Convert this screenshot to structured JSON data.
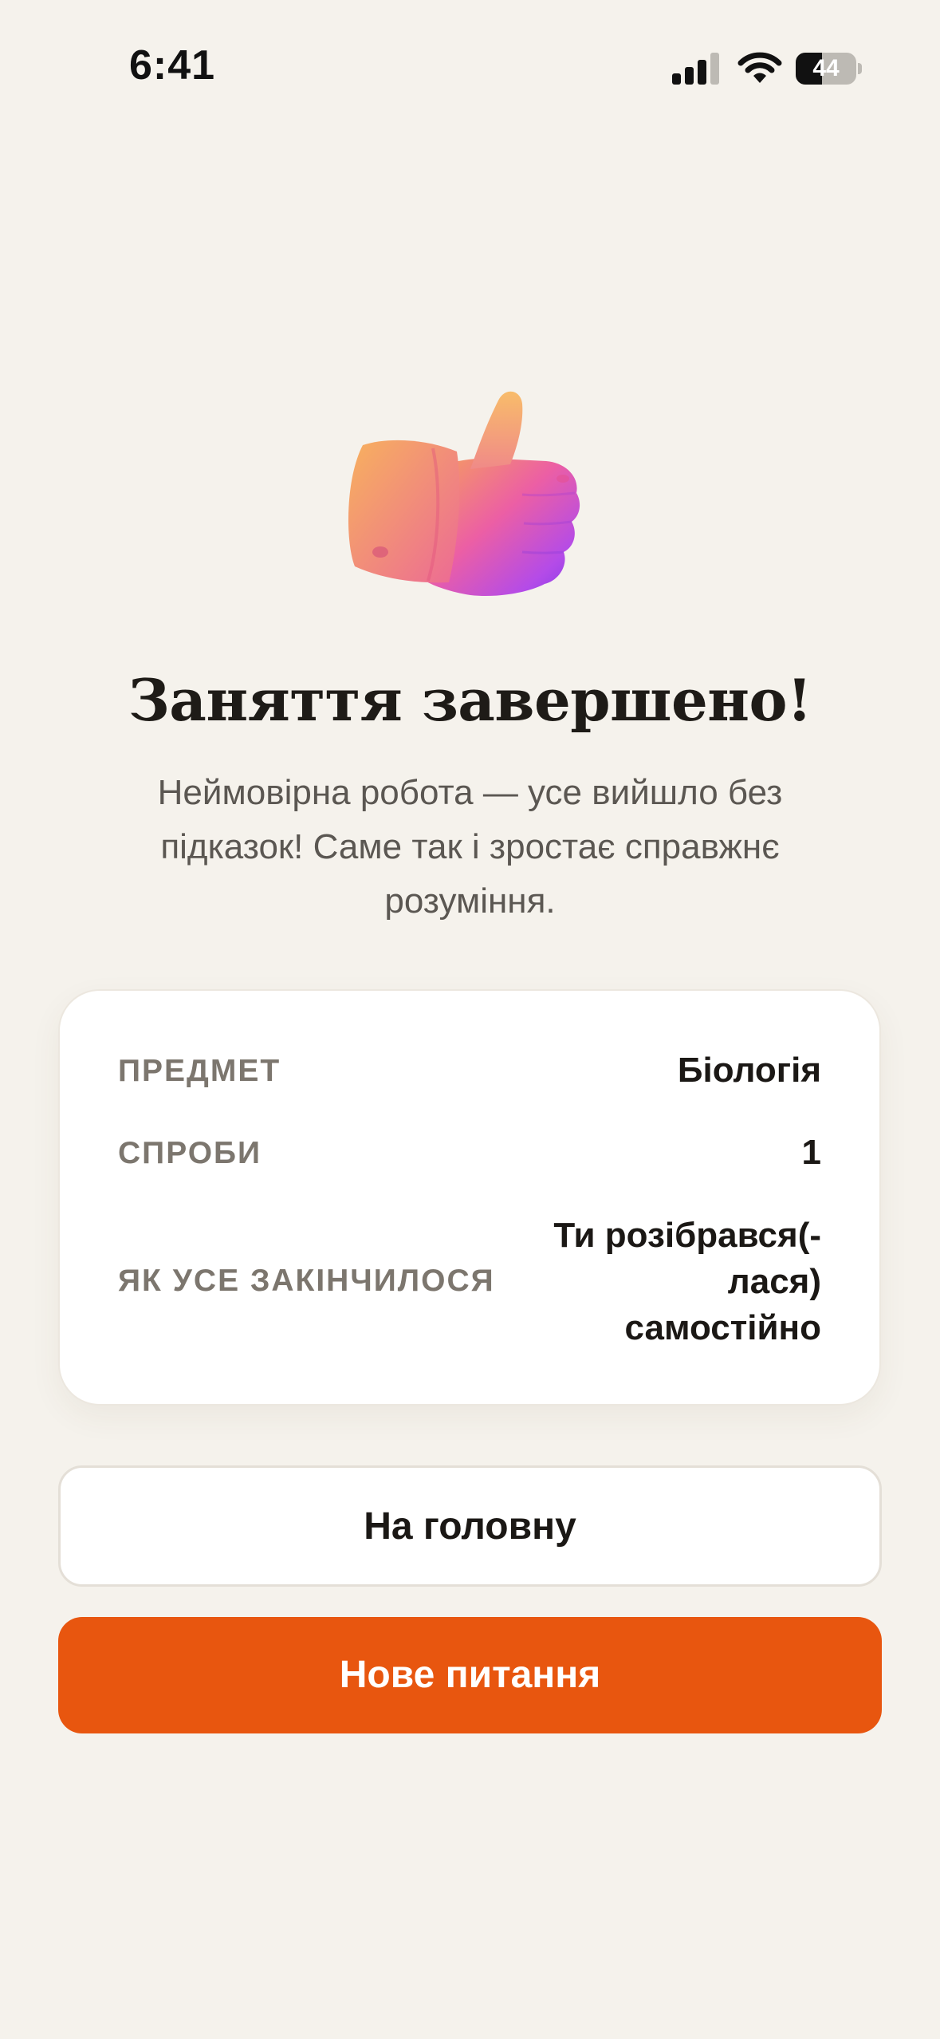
{
  "status_bar": {
    "time": "6:41",
    "battery_level": "44",
    "battery_fraction": 0.44
  },
  "icons": {
    "hero": "thumbs-up-icon",
    "signal": "cellular-signal-icon",
    "wifi": "wifi-icon",
    "battery": "battery-icon"
  },
  "completion": {
    "title": "Заняття завершено!",
    "subtitle": "Неймовірна робота — усе вийшло без підказок! Саме так і зростає справжнє розуміння."
  },
  "summary": {
    "rows": [
      {
        "label": "ПРЕДМЕТ",
        "value": "Біологія"
      },
      {
        "label": "СПРОБИ",
        "value": "1"
      },
      {
        "label": "ЯК УСЕ ЗАКІНЧИЛОСЯ",
        "value": "Ти розібрався(-лася) самостійно"
      }
    ]
  },
  "actions": {
    "home_label": "На головну",
    "new_question_label": "Нове питання"
  },
  "colors": {
    "background": "#F5F2EC",
    "accent": "#E8560F",
    "title_text": "#1E1B17",
    "muted_text": "#7C766E"
  }
}
